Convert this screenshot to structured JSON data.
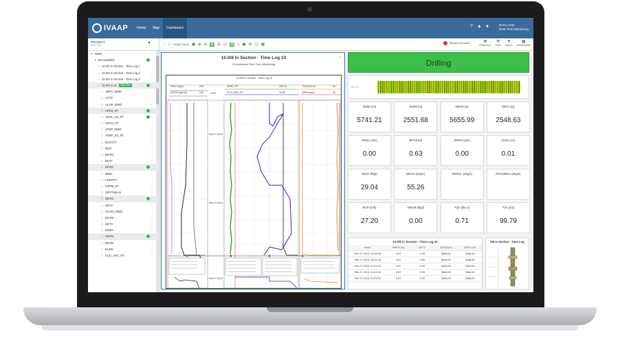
{
  "app": {
    "logo": "IVAAP",
    "nav": [
      {
        "label": "Home",
        "active": false
      },
      {
        "label": "Map",
        "active": false
      },
      {
        "label": "Dashboard",
        "active": true
      }
    ],
    "user": {
      "name": "Demo User",
      "role": "Real-Time Monitoring"
    }
  },
  "toolbar": {
    "project": "PROJECT",
    "project_sub": "Real-Time",
    "depth_mode": "Single Depth",
    "range": "Second 24 hours",
    "tools": [
      "Projection",
      "Tools",
      "Filters",
      "Dashboards"
    ]
  },
  "tree": {
    "items": [
      {
        "label": "Wells",
        "indent": 0,
        "badge": false,
        "alt": false
      },
      {
        "label": "DemoWell01",
        "indent": 1,
        "badge": true,
        "alt": false
      },
      {
        "label": "10.0/8 in Section - Time Log 1",
        "indent": 2,
        "badge": false,
        "alt": false
      },
      {
        "label": "10.0/8 in Section - Time Log 2",
        "indent": 2,
        "badge": false,
        "alt": false
      },
      {
        "label": "10.0/8 in Section - Time Log 3",
        "indent": 2,
        "badge": false,
        "alt": false
      },
      {
        "label": "10.0/8 in Se",
        "indent": 2,
        "badge": true,
        "alt": true,
        "live": "Real-Time"
      },
      {
        "label": "ABPH_MWD",
        "indent": 3,
        "badge": false,
        "alt": false
      },
      {
        "label": "ACTC",
        "indent": 3,
        "badge": false,
        "alt": false
      },
      {
        "label": "ALAM_MWD",
        "indent": 3,
        "badge": false,
        "alt": false
      },
      {
        "label": "APRS_RT",
        "indent": 3,
        "badge": true,
        "alt": true
      },
      {
        "label": "ARGL_SS_RT",
        "indent": 3,
        "badge": true,
        "alt": false
      },
      {
        "label": "ARGS_RT",
        "indent": 3,
        "badge": false,
        "alt": false
      },
      {
        "label": "ATMP_MWD",
        "indent": 3,
        "badge": false,
        "alt": false
      },
      {
        "label": "ATMP_SS_RT",
        "indent": 3,
        "badge": false,
        "alt": false
      },
      {
        "label": "BACKCT",
        "indent": 3,
        "badge": false,
        "alt": false
      },
      {
        "label": "BDIT",
        "indent": 3,
        "badge": false,
        "alt": false
      },
      {
        "label": "BDTM",
        "indent": 3,
        "badge": false,
        "alt": false
      },
      {
        "label": "BDTT",
        "indent": 3,
        "badge": false,
        "alt": false
      },
      {
        "label": "BPOS",
        "indent": 3,
        "badge": true,
        "alt": true
      },
      {
        "label": "BREL",
        "indent": 3,
        "badge": false,
        "alt": false
      },
      {
        "label": "CDEPTH",
        "indent": 3,
        "badge": false,
        "alt": false
      },
      {
        "label": "CRPM_RT",
        "indent": 3,
        "badge": false,
        "alt": false
      },
      {
        "label": "DEPTMEAS",
        "indent": 3,
        "badge": false,
        "alt": false
      },
      {
        "label": "DBTM",
        "indent": 3,
        "badge": true,
        "alt": true
      },
      {
        "label": "DBTV",
        "indent": 3,
        "badge": false,
        "alt": false
      },
      {
        "label": "DCHM_MWD",
        "indent": 3,
        "badge": false,
        "alt": false
      },
      {
        "label": "DDTM",
        "indent": 3,
        "badge": false,
        "alt": false
      },
      {
        "label": "DDTV",
        "indent": 3,
        "badge": false,
        "alt": false
      },
      {
        "label": "DMEA",
        "indent": 3,
        "badge": false,
        "alt": false
      },
      {
        "label": "DRPM",
        "indent": 3,
        "badge": true,
        "alt": true
      },
      {
        "label": "DRTM",
        "indent": 3,
        "badge": false,
        "alt": false
      },
      {
        "label": "DVER",
        "indent": 3,
        "badge": false,
        "alt": false
      },
      {
        "label": "ECD_ARC_RT",
        "indent": 3,
        "badge": false,
        "alt": false
      }
    ]
  },
  "log_panel": {
    "title": "10.0/8 in Section - Time Log 10",
    "subtitle": "Consolidated Real-Time Monitoring",
    "inner_title": "10.0/8 in Section - Time Log 10",
    "time_label": "Time",
    "dates": [
      "Feb 27 2013",
      "Feb 27 2013",
      "Feb 27 2013"
    ],
    "headers": {
      "t1a": "HKLD (kpa)",
      "t1a_range": "200",
      "t1b": "MDOA (kg/m3)",
      "t1b_range": "200",
      "t2a": "APRS_RT",
      "t2a_range": "100.00",
      "t2b": "ECD_ARC_RT",
      "t2b_range": "10.00",
      "t3a": "TQA (kN.m)",
      "t3a_range": "50",
      "t3b": "RPM (rpm)",
      "t3b_range": "25"
    }
  },
  "status": {
    "label": "Drilling",
    "color": "#3cbf4a"
  },
  "actc": {
    "label": "ACTC"
  },
  "tiles": [
    {
      "label": "DMEA [m]",
      "value": "5741.21"
    },
    {
      "label": "DVER [m]",
      "value": "2551.68"
    },
    {
      "label": "DBTM [m]",
      "value": "5655.99"
    },
    {
      "label": "DBTV [m]",
      "value": "2548.63"
    },
    {
      "label": "SWEL (mm)",
      "value": "0.00"
    },
    {
      "label": "BPOS [m]",
      "value": "0.63"
    },
    {
      "label": "DRPM (rpm)",
      "value": "0.00"
    },
    {
      "label": "GASA (%)",
      "value": "0.01"
    },
    {
      "label": "HKLD (kkgf)",
      "value": "29.04"
    },
    {
      "label": "MDOA (deg/C)",
      "value": "55.26"
    },
    {
      "label": "PDINCL (deg/s)",
      "value": ""
    },
    {
      "label": "PDAZIMUC (deg/s)",
      "value": ""
    },
    {
      "label": "ROP (m/h)",
      "value": "27.20"
    },
    {
      "label": "SWOB (kkgf)",
      "value": "0.00"
    },
    {
      "label": "TQA (kN.m)",
      "value": "0.71"
    },
    {
      "label": "TVA (m3)",
      "value": "99.79"
    }
  ],
  "table": {
    "title": "10.0/8 in Section - Time Log 10",
    "columns": [
      "Index",
      "BPOS (m)",
      "ACTC",
      "DBTM (m)",
      "DBTV (m)"
    ],
    "rows": [
      [
        "Feb 27 2013, 21:03:26",
        "0.67",
        "2.00",
        "5656.00",
        "2548.63"
      ],
      [
        "Feb 27 2013, 21:03:28",
        "0.67",
        "2.00",
        "5656.00",
        "2548.63"
      ],
      [
        "Feb 27 2013, 21:03:29",
        "0.67",
        "2.00",
        "5656.00",
        "2548.63"
      ],
      [
        "Feb 27 2013, 21:03:30",
        "0.67",
        "2.00",
        "5656.00",
        "2548.63"
      ],
      [
        "Feb 27 2013, 21:03:32",
        "0.67",
        "2.00",
        "5656.00",
        "2548.63"
      ]
    ]
  },
  "mini": {
    "title": "5/8 in Section - Time Log"
  }
}
